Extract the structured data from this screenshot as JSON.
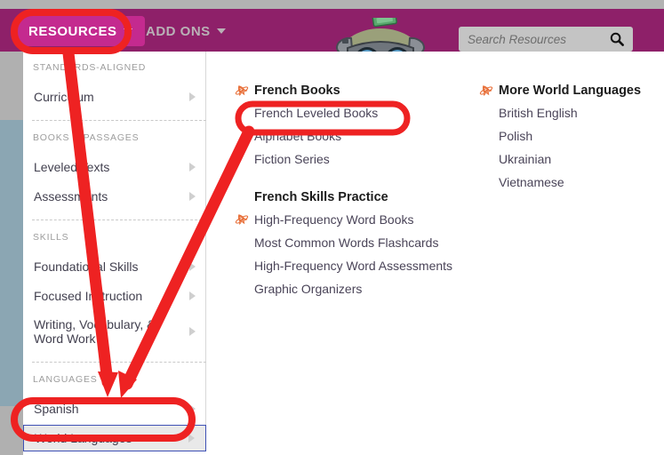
{
  "colors": {
    "navbar_bg": "#8e2069",
    "resources_btn_bg": "#c42a8f",
    "top_strip": "#b2b2b2",
    "edge_blue": "#8ba6b3",
    "annotation_red": "#ee2222",
    "rocket_orange": "#e8703a",
    "link_text": "#4a4458",
    "section_label": "#9d9d9d",
    "active_border": "#3f51b5"
  },
  "navbar": {
    "resources": {
      "label": "RESOURCES",
      "icon": "caret-down-icon"
    },
    "addons": {
      "label": "ADD ONS",
      "icon": "caret-down-icon"
    },
    "mascot_icon": "mascot-robot-icon",
    "search": {
      "placeholder": "Search Resources",
      "value": "",
      "icon": "search-icon"
    }
  },
  "sidebar": {
    "sections": [
      {
        "label": "STANDARDS-ALIGNED",
        "items": [
          {
            "label": "Curriculum",
            "has_chevron": true,
            "active": false
          }
        ]
      },
      {
        "label": "BOOKS & PASSAGES",
        "items": [
          {
            "label": "Leveled Texts",
            "has_chevron": true,
            "active": false
          },
          {
            "label": "Assessments",
            "has_chevron": true,
            "active": false
          }
        ]
      },
      {
        "label": "SKILLS",
        "items": [
          {
            "label": "Foundational Skills",
            "has_chevron": true,
            "active": false
          },
          {
            "label": "Focused Instruction",
            "has_chevron": true,
            "active": false
          },
          {
            "label": "Writing, Vocabulary, & Word Work",
            "has_chevron": true,
            "active": false,
            "two_line": true
          }
        ]
      },
      {
        "label": "LANGUAGES",
        "items": [
          {
            "label": "Spanish",
            "has_chevron": true,
            "active": false
          },
          {
            "label": "World Languages",
            "has_chevron": true,
            "active": true
          }
        ]
      }
    ]
  },
  "panel": {
    "columns": [
      {
        "name": "middle",
        "groups": [
          {
            "title": "French Books",
            "title_icon": "rocket-icon",
            "links": [
              {
                "label": "French Leveled Books",
                "icon": null
              },
              {
                "label": "Alphabet Books",
                "icon": null
              },
              {
                "label": "Fiction Series",
                "icon": null
              }
            ]
          },
          {
            "title": "French Skills Practice",
            "title_icon": null,
            "links": [
              {
                "label": "High-Frequency Word Books",
                "icon": "rocket-icon"
              },
              {
                "label": "Most Common Words Flashcards",
                "icon": null
              },
              {
                "label": "High-Frequency Word Assessments",
                "icon": null
              },
              {
                "label": "Graphic Organizers",
                "icon": null
              }
            ]
          }
        ]
      },
      {
        "name": "right",
        "groups": [
          {
            "title": "More World Languages",
            "title_icon": "rocket-icon",
            "links": [
              {
                "label": "British English",
                "icon": null
              },
              {
                "label": "Polish",
                "icon": null
              },
              {
                "label": "Ukrainian",
                "icon": null
              },
              {
                "label": "Vietnamese",
                "icon": null
              }
            ]
          }
        ]
      }
    ]
  },
  "annotations": {
    "ellipses": [
      {
        "target": "RESOURCES",
        "name": "annotation-ellipse-resources"
      },
      {
        "target": "World Languages",
        "name": "annotation-ellipse-world-languages"
      },
      {
        "target": "French Leveled Books",
        "name": "annotation-ellipse-french-leveled-books"
      }
    ],
    "arrows": [
      {
        "from": "RESOURCES",
        "to": "World Languages",
        "name": "annotation-arrow-resources-to-world-languages"
      },
      {
        "from": "French Leveled Books",
        "to": "World Languages",
        "name": "annotation-arrow-french-leveled-books-to-world-languages"
      }
    ]
  }
}
